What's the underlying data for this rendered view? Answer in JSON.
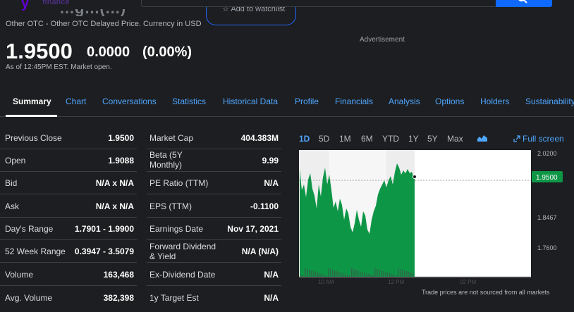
{
  "header": {
    "logo_text": "finance",
    "ticker_partial": "…g…(…)",
    "watchlist_label": "Add to watchlist",
    "exchange_info": "Other OTC - Other OTC Delayed Price. Currency in USD",
    "advertisement": "Advertisement"
  },
  "quote": {
    "price": "1.9500",
    "change": "0.0000",
    "change_pct": "(0.00%)",
    "as_of": "As of 12:45PM EST. Market open."
  },
  "tabs": [
    "Summary",
    "Chart",
    "Conversations",
    "Statistics",
    "Historical Data",
    "Profile",
    "Financials",
    "Analysis",
    "Options",
    "Holders",
    "Sustainability"
  ],
  "stats_left": [
    {
      "label": "Previous Close",
      "value": "1.9500"
    },
    {
      "label": "Open",
      "value": "1.9088"
    },
    {
      "label": "Bid",
      "value": "N/A x N/A"
    },
    {
      "label": "Ask",
      "value": "N/A x N/A"
    },
    {
      "label": "Day's Range",
      "value": "1.7901 - 1.9900"
    },
    {
      "label": "52 Week Range",
      "value": "0.3947 - 3.5079"
    },
    {
      "label": "Volume",
      "value": "163,468"
    },
    {
      "label": "Avg. Volume",
      "value": "382,398"
    }
  ],
  "stats_right": [
    {
      "label": "Market Cap",
      "value": "404.383M"
    },
    {
      "label": "Beta (5Y Monthly)",
      "value": "9.99"
    },
    {
      "label": "PE Ratio (TTM)",
      "value": "N/A"
    },
    {
      "label": "EPS (TTM)",
      "value": "-0.1100"
    },
    {
      "label": "Earnings Date",
      "value": "Nov 17, 2021"
    },
    {
      "label": "Forward Dividend & Yield",
      "value": "N/A (N/A)"
    },
    {
      "label": "Ex-Dividend Date",
      "value": "N/A"
    },
    {
      "label": "1y Target Est",
      "value": "N/A"
    }
  ],
  "chart": {
    "ranges": [
      "1D",
      "5D",
      "1M",
      "6M",
      "YTD",
      "1Y",
      "5Y",
      "Max"
    ],
    "active_range": "1D",
    "fullscreen_label": "Full screen",
    "y_labels": [
      "2.0200",
      "1.8467",
      "1.7600"
    ],
    "current_price_tag": "1.9500",
    "x_labels": [
      "10 AM",
      "12 PM",
      "02 PM"
    ],
    "footnote": "Trade prices are not sourced from all markets",
    "line_color": "#0e9647",
    "tag_color": "#0e9647",
    "icons": [
      "search-icon",
      "star-icon",
      "mountain-chart-icon",
      "expand-icon"
    ]
  }
}
